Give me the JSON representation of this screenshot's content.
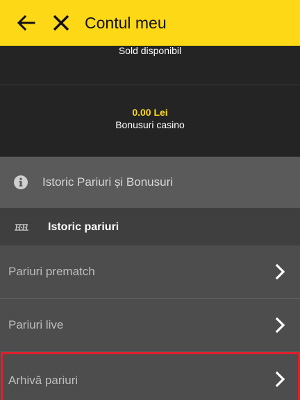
{
  "header": {
    "title": "Contul meu",
    "back_icon": "arrow-left-icon",
    "close_icon": "close-icon",
    "background": "#fdd816"
  },
  "balance": {
    "sold_label": "Sold disponibil",
    "bonus_amount": "0.00 Lei",
    "bonus_label": "Bonusuri casino"
  },
  "history": {
    "icon": "info-icon",
    "label": "Istoric Pariuri și Bonusuri"
  },
  "section": {
    "icon": "ticket-icon",
    "title": "Istoric pariuri"
  },
  "menu": [
    {
      "label": "Pariuri prematch",
      "icon": "chevron-right-icon"
    },
    {
      "label": "Pariuri live",
      "icon": "chevron-right-icon"
    },
    {
      "label": "Arhivă pariuri",
      "icon": "chevron-right-icon",
      "highlighted": true
    }
  ],
  "colors": {
    "accent": "#fdd816",
    "highlight_border": "#e01e2a"
  }
}
